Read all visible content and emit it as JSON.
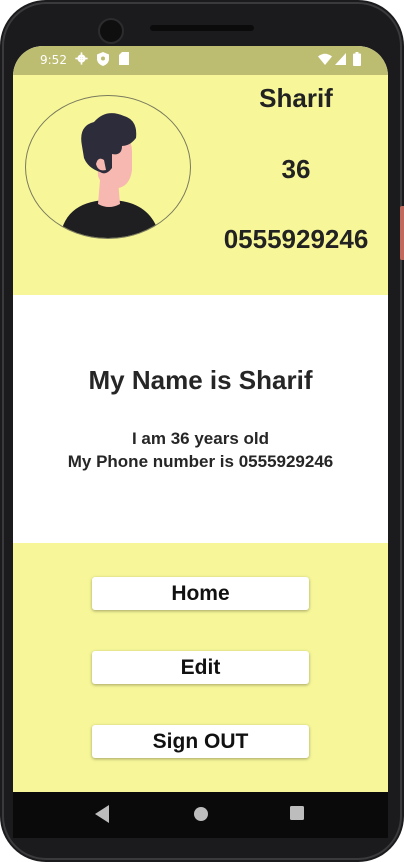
{
  "status_bar": {
    "time": "9:52",
    "icons": [
      "settings-icon",
      "shield-icon",
      "sd-card-icon",
      "wifi-icon",
      "signal-icon",
      "battery-icon"
    ]
  },
  "profile": {
    "name": "Sharif",
    "age": "36",
    "phone": "0555929246"
  },
  "info": {
    "title": "My Name is Sharif",
    "age_line": "I am 36 years old",
    "phone_line": "My Phone number is 0555929246"
  },
  "buttons": {
    "home": "Home",
    "edit": "Edit",
    "sign_out": "Sign OUT"
  },
  "nav": [
    "back-icon",
    "home-circle-icon",
    "recents-icon"
  ],
  "colors": {
    "header_bg": "#f7f799",
    "status_bar_bg": "#bdbd72",
    "button_bg": "#ffffff",
    "text": "#222222"
  }
}
